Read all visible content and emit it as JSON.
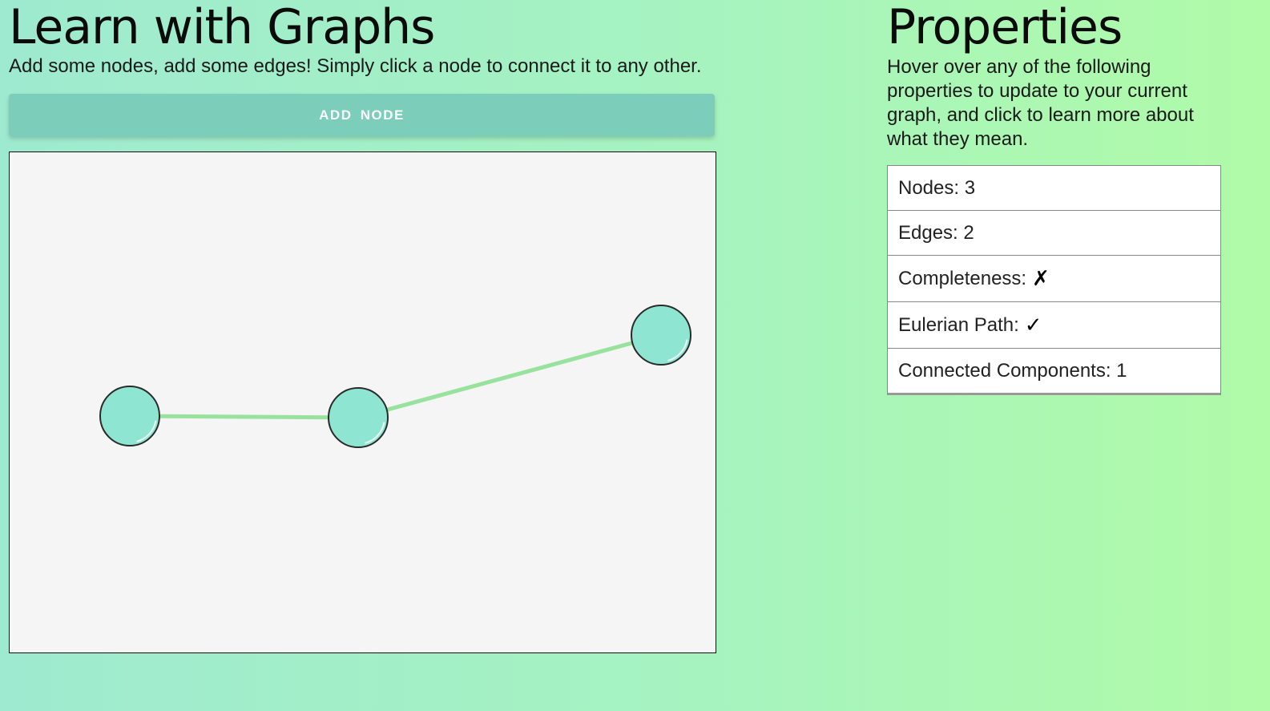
{
  "header": {
    "title": "Learn with Graphs",
    "subtitle": "Add some nodes, add some edges! Simply click a node to connect it to any other."
  },
  "toolbar": {
    "add_node_label": "ADD  NODE"
  },
  "graph": {
    "node_color": "#8ee6d2",
    "edge_color": "#97e39e",
    "nodes": [
      {
        "id": "a"
      },
      {
        "id": "b"
      },
      {
        "id": "c"
      }
    ],
    "edges": [
      {
        "from": "a",
        "to": "b"
      },
      {
        "from": "b",
        "to": "c"
      }
    ]
  },
  "properties": {
    "title": "Properties",
    "description": "Hover over any of the following properties to update to your current graph, and click to learn more about what they mean.",
    "nodes_label": "Nodes:",
    "nodes_value": "3",
    "edges_label": "Edges:",
    "edges_value": "2",
    "completeness_label": "Completeness:",
    "completeness_value": "✗",
    "eulerian_label": "Eulerian Path:",
    "eulerian_value": "✓",
    "components_label": "Connected Components:",
    "components_value": "1"
  }
}
